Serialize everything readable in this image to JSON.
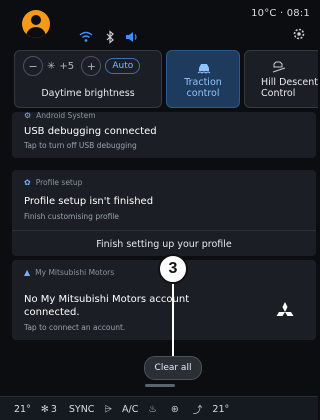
{
  "status_bar": {
    "time": "10°C · 08:1",
    "wifi_icon": "wifi-icon",
    "bluetooth_icon": "bluetooth-icon",
    "audio_icon": "audio-icon",
    "settings_icon": "gear-icon"
  },
  "quick_settings": {
    "brightness": {
      "minus": "−",
      "value": "+5",
      "plus": "+",
      "auto": "Auto",
      "label": "Daytime brightness"
    },
    "traction": {
      "label": "Traction control"
    },
    "hill_descent": {
      "label": "Hill Descent Control"
    }
  },
  "notifications": [
    {
      "app": "Android System",
      "title": "USB debugging connected",
      "subtitle": "Tap to turn off USB debugging"
    },
    {
      "app": "Profile setup",
      "title": "Profile setup isn't finished",
      "subtitle": "Finish customising profile",
      "action": "Finish setting up your profile"
    },
    {
      "app": "My Mitsubishi Motors",
      "title_line1": "No My Mitsubishi Motors account",
      "title_line2": "connected.",
      "subtitle": "Tap to connect an account."
    }
  ],
  "callout": "3",
  "clear_all": "Clear all",
  "climate_bar": {
    "left_temp": "21°",
    "fan": "3",
    "sync": "SYNC",
    "ac": "A/C",
    "right_temp": "21°"
  },
  "colors": {
    "accent": "#f39a1a",
    "traction_bg": "#1e3a5c",
    "traction_text": "#8fc4ff"
  }
}
